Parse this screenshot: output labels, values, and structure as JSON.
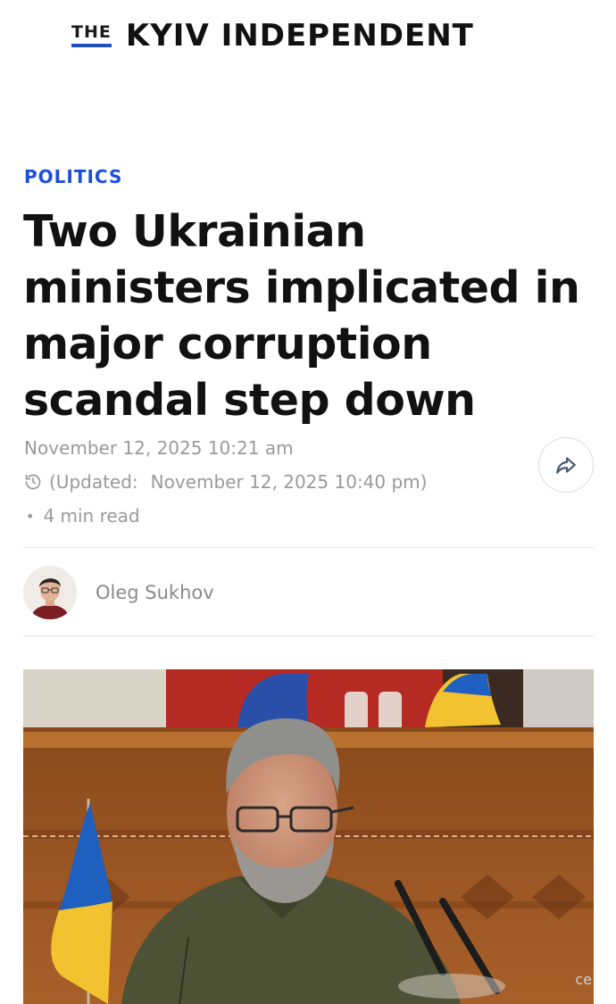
{
  "masthead": {
    "logo_the": "THE",
    "logo_name": "KYIV INDEPENDENT",
    "brand_color": "#1f4fbf"
  },
  "article": {
    "category": "POLITICS",
    "category_color": "#1d4ed8",
    "headline_lines": [
      "Two Ukrainian",
      "ministers implicated in",
      "major corruption",
      "scandal step down"
    ],
    "published": "November 12, 2025 10:21 am",
    "updated_label": "(Updated:",
    "updated_value": "November 12, 2025 10:40 pm)",
    "read_time": "4 min read",
    "share_icon": "share-arrow-icon",
    "clock_icon": "history-clock-icon"
  },
  "author": {
    "name": "Oleg Sukhov"
  },
  "hero_image": {
    "caption_fragment": "ce"
  }
}
